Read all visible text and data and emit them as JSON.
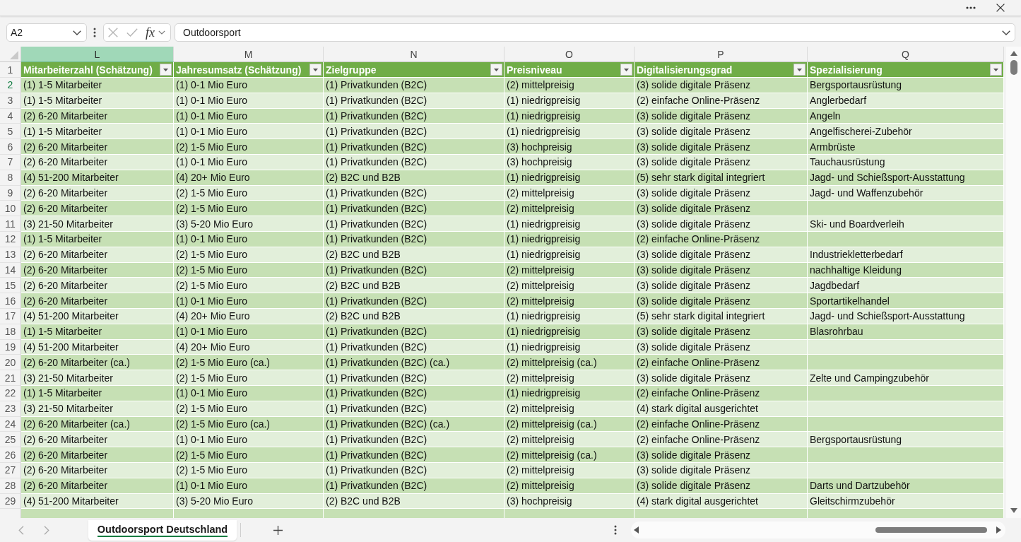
{
  "formula_bar": {
    "name_box": "A2",
    "function_label": "fx",
    "formula": "Outdoorsport"
  },
  "columns": [
    {
      "letter": "L",
      "selected": true
    },
    {
      "letter": "M",
      "selected": false
    },
    {
      "letter": "N",
      "selected": false
    },
    {
      "letter": "O",
      "selected": false
    },
    {
      "letter": "P",
      "selected": false
    },
    {
      "letter": "Q",
      "selected": false
    }
  ],
  "header_row": {
    "number": "1",
    "titles": [
      "Mitarbeiterzahl (Schätzung)",
      "Jahresumsatz (Schätzung)",
      "Zielgruppe",
      "Preisniveau",
      "Digitalisierungsgrad",
      "Spezialisierung"
    ]
  },
  "rows": [
    {
      "number": "2",
      "selected": true,
      "cells": [
        "(1) 1-5 Mitarbeiter",
        "(1) 0-1 Mio Euro",
        "(1) Privatkunden (B2C)",
        "(2) mittelpreisig",
        "(3) solide digitale Präsenz",
        "Bergsportausrüstung"
      ]
    },
    {
      "number": "3",
      "selected": false,
      "cells": [
        "(1) 1-5 Mitarbeiter",
        "(1) 0-1 Mio Euro",
        "(1) Privatkunden (B2C)",
        "(1) niedrigpreisig",
        "(2) einfache Online-Präsenz",
        "Anglerbedarf"
      ]
    },
    {
      "number": "4",
      "selected": false,
      "cells": [
        "(2) 6-20 Mitarbeiter",
        "(1) 0-1 Mio Euro",
        "(1) Privatkunden (B2C)",
        "(1) niedrigpreisig",
        "(3) solide digitale Präsenz",
        "Angeln"
      ]
    },
    {
      "number": "5",
      "selected": false,
      "cells": [
        "(1) 1-5 Mitarbeiter",
        "(1) 0-1 Mio Euro",
        "(1) Privatkunden (B2C)",
        "(1) niedrigpreisig",
        "(3) solide digitale Präsenz",
        "Angelfischerei-Zubehör"
      ]
    },
    {
      "number": "6",
      "selected": false,
      "cells": [
        "(2) 6-20 Mitarbeiter",
        "(2) 1-5 Mio Euro",
        "(1) Privatkunden (B2C)",
        "(3) hochpreisig",
        "(3) solide digitale Präsenz",
        "Armbrüste"
      ]
    },
    {
      "number": "7",
      "selected": false,
      "cells": [
        "(2) 6-20 Mitarbeiter",
        "(1) 0-1 Mio Euro",
        "(1) Privatkunden (B2C)",
        "(3) hochpreisig",
        "(3) solide digitale Präsenz",
        "Tauchausrüstung"
      ]
    },
    {
      "number": "8",
      "selected": false,
      "cells": [
        "(4) 51-200 Mitarbeiter",
        "(4) 20+ Mio Euro",
        "(2) B2C und B2B",
        "(1) niedrigpreisig",
        "(5) sehr stark digital integriert",
        "Jagd- und Schießsport-Ausstattung"
      ]
    },
    {
      "number": "9",
      "selected": false,
      "cells": [
        "(2) 6-20 Mitarbeiter",
        "(2) 1-5 Mio Euro",
        "(1) Privatkunden (B2C)",
        "(2) mittelpreisig",
        "(3) solide digitale Präsenz",
        "Jagd- und Waffenzubehör"
      ]
    },
    {
      "number": "10",
      "selected": false,
      "cells": [
        "(2) 6-20 Mitarbeiter",
        "(2) 1-5 Mio Euro",
        "(1) Privatkunden (B2C)",
        "(2) mittelpreisig",
        "(3) solide digitale Präsenz",
        null
      ]
    },
    {
      "number": "11",
      "selected": false,
      "cells": [
        "(3) 21-50 Mitarbeiter",
        "(3) 5-20 Mio Euro",
        "(1) Privatkunden (B2C)",
        "(1) niedrigpreisig",
        "(3) solide digitale Präsenz",
        "Ski- und Boardverleih"
      ]
    },
    {
      "number": "12",
      "selected": false,
      "cells": [
        "(1) 1-5 Mitarbeiter",
        "(1) 0-1 Mio Euro",
        "(1) Privatkunden (B2C)",
        "(1) niedrigpreisig",
        "(2) einfache Online-Präsenz",
        null
      ]
    },
    {
      "number": "13",
      "selected": false,
      "cells": [
        "(2) 6-20 Mitarbeiter",
        "(2) 1-5 Mio Euro",
        "(2) B2C und B2B",
        "(1) niedrigpreisig",
        "(3) solide digitale Präsenz",
        "Industriekletterbedarf"
      ]
    },
    {
      "number": "14",
      "selected": false,
      "cells": [
        "(2) 6-20 Mitarbeiter",
        "(2) 1-5 Mio Euro",
        "(1) Privatkunden (B2C)",
        "(2) mittelpreisig",
        "(3) solide digitale Präsenz",
        "nachhaltige Kleidung"
      ]
    },
    {
      "number": "15",
      "selected": false,
      "cells": [
        "(2) 6-20 Mitarbeiter",
        "(2) 1-5 Mio Euro",
        "(2) B2C und B2B",
        "(2) mittelpreisig",
        "(3) solide digitale Präsenz",
        "Jagdbedarf"
      ]
    },
    {
      "number": "16",
      "selected": false,
      "cells": [
        "(2) 6-20 Mitarbeiter",
        "(1) 0-1 Mio Euro",
        "(1) Privatkunden (B2C)",
        "(2) mittelpreisig",
        "(3) solide digitale Präsenz",
        "Sportartikelhandel"
      ]
    },
    {
      "number": "17",
      "selected": false,
      "cells": [
        "(4) 51-200 Mitarbeiter",
        "(4) 20+ Mio Euro",
        "(2) B2C und B2B",
        "(1) niedrigpreisig",
        "(5) sehr stark digital integriert",
        "Jagd- und Schießsport-Ausstattung"
      ]
    },
    {
      "number": "18",
      "selected": false,
      "cells": [
        "(1) 1-5 Mitarbeiter",
        "(1) 0-1 Mio Euro",
        "(1) Privatkunden (B2C)",
        "(1) niedrigpreisig",
        "(3) solide digitale Präsenz",
        "Blasrohrbau"
      ]
    },
    {
      "number": "19",
      "selected": false,
      "cells": [
        "(4) 51-200 Mitarbeiter",
        "(4) 20+ Mio Euro",
        "(1) Privatkunden (B2C)",
        "(1) niedrigpreisig",
        "(3) solide digitale Präsenz",
        null
      ]
    },
    {
      "number": "20",
      "selected": false,
      "cells": [
        "(2) 6-20 Mitarbeiter (ca.)",
        "(2) 1-5 Mio Euro (ca.)",
        "(1) Privatkunden (B2C) (ca.)",
        "(2) mittelpreisig (ca.)",
        "(2) einfache Online-Präsenz",
        null
      ]
    },
    {
      "number": "21",
      "selected": false,
      "cells": [
        "(3) 21-50 Mitarbeiter",
        "(2) 1-5 Mio Euro",
        "(1) Privatkunden (B2C)",
        "(2) mittelpreisig",
        "(3) solide digitale Präsenz",
        "Zelte und Campingzubehör"
      ]
    },
    {
      "number": "22",
      "selected": false,
      "cells": [
        "(1) 1-5 Mitarbeiter",
        "(1) 0-1 Mio Euro",
        "(1) Privatkunden (B2C)",
        "(1) niedrigpreisig",
        "(2) einfache Online-Präsenz",
        null
      ]
    },
    {
      "number": "23",
      "selected": false,
      "cells": [
        "(3) 21-50 Mitarbeiter",
        "(2) 1-5 Mio Euro",
        "(1) Privatkunden (B2C)",
        "(2) mittelpreisig",
        "(4) stark digital ausgerichtet",
        null
      ]
    },
    {
      "number": "24",
      "selected": false,
      "cells": [
        "(2) 6-20 Mitarbeiter (ca.)",
        "(2) 1-5 Mio Euro (ca.)",
        "(1) Privatkunden (B2C) (ca.)",
        "(2) mittelpreisig (ca.)",
        "(2) einfache Online-Präsenz",
        null
      ]
    },
    {
      "number": "25",
      "selected": false,
      "cells": [
        "(2) 6-20 Mitarbeiter",
        "(1) 0-1 Mio Euro",
        "(1) Privatkunden (B2C)",
        "(2) mittelpreisig",
        "(2) einfache Online-Präsenz",
        "Bergsportausrüstung"
      ]
    },
    {
      "number": "26",
      "selected": false,
      "cells": [
        "(2) 6-20 Mitarbeiter",
        "(2) 1-5 Mio Euro",
        "(1) Privatkunden (B2C)",
        "(2) mittelpreisig (ca.)",
        "(3) solide digitale Präsenz",
        null
      ]
    },
    {
      "number": "27",
      "selected": false,
      "cells": [
        "(2) 6-20 Mitarbeiter",
        "(2) 1-5 Mio Euro",
        "(1) Privatkunden (B2C)",
        "(2) mittelpreisig",
        "(3) solide digitale Präsenz",
        null
      ]
    },
    {
      "number": "28",
      "selected": false,
      "cells": [
        "(2) 6-20 Mitarbeiter",
        "(1) 0-1 Mio Euro",
        "(1) Privatkunden (B2C)",
        "(2) mittelpreisig",
        "(3) solide digitale Präsenz",
        "Darts und Dartzubehör"
      ]
    },
    {
      "number": "29",
      "selected": false,
      "cells": [
        "(4) 51-200 Mitarbeiter",
        "(3) 5-20 Mio Euro",
        "(2) B2C und B2B",
        "(3) hochpreisig",
        "(4) stark digital ausgerichtet",
        "Gleitschirmzubehör"
      ]
    }
  ],
  "sheet_tabs": [
    {
      "label": "Outdoorsport Deutschland",
      "selected": true
    }
  ]
}
